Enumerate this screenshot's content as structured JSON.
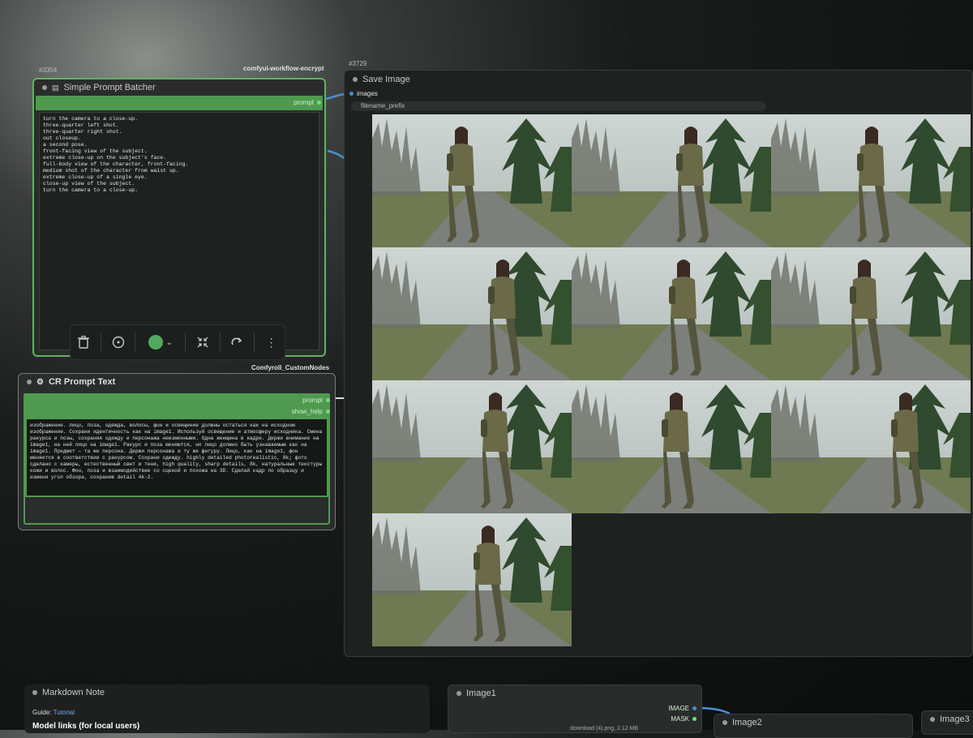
{
  "badges": {
    "batcher_id": "#3354",
    "save_id": "#3729",
    "batcher_source": "comfyui-workflow-encrypt",
    "cr_source": "Comfyroll_CustomNodes"
  },
  "batcher": {
    "title": "Simple Prompt Batcher",
    "output_label": "prompt",
    "lines": [
      "turn the camera to a close-up.",
      "three-quarter left shot.",
      "three-quarter right shot.",
      "out closeup.",
      "a second pose.",
      "front-facing view of the subject.",
      "extreme close-up on the subject's face.",
      "full-body view of the character, front-facing.",
      "medium shot of the character from waist up.",
      "extreme close-up of a single eye.",
      "close-up view of the subject.",
      "turn the camera to a close-up."
    ]
  },
  "toolbar": {
    "delete": "delete-icon",
    "info": "info-icon",
    "color": "color-picker",
    "color_value": "#4faa5f",
    "bypass": "collapse-icon",
    "redo": "redo-icon",
    "more": "more-icon"
  },
  "cr_prompt": {
    "title": "CR Prompt Text",
    "output_prompt": "prompt",
    "output_help": "show_help",
    "text": "изображение. лицо, поза, одежда, волосы, фон и освещение должны остаться как на исходном изображении. Сохрани идентичность как на image1. Используй освещение и атмосферу исходника. Смена ракурса и позы, сохраняя одежду и персонажа неизменными. Одна женщина в кадре. Держи внимание на image1, на ней лицо на image1. Ракурс и поза меняются, но лицо должно быть узнаваемым как на image1. Предмет — та же персона. Держи персонажа и ту же фигуру. Лицо, как на image1, фон меняется в соответствии с ракурсом. Сохрани одежду. highly detailed photorealistic, 8k; фото сделано с камеры, естественный свет и тени, high quality, sharp details, 8k, натуральные текстуры кожи и волос. Фон, поза и взаимодействие со сценой и похожа на 3D. Сделай кадр по образцу и измени угол обзора, сохранив detail 4k-2."
  },
  "save": {
    "title": "Save Image",
    "input_label": "images",
    "widget_label": "filename_prefix",
    "images": [
      "woman-walking-1",
      "woman-walking-2",
      "woman-walking-3",
      "woman-walking-4",
      "woman-walking-5",
      "woman-walking-6",
      "woman-walking-7",
      "woman-walking-8",
      "woman-walking-9",
      "woman-walking-10"
    ]
  },
  "md_note": {
    "title": "Markdown Note",
    "guide_label": "Guide:",
    "guide_link": "Tutorial",
    "heading": "Model links (for local users)"
  },
  "image1": {
    "title": "Image1",
    "out_image": "IMAGE",
    "out_mask": "MASK",
    "file": "download (4).png, 2.12 MB"
  },
  "image2": {
    "title": "Image2"
  },
  "image3": {
    "title": "Image3"
  }
}
